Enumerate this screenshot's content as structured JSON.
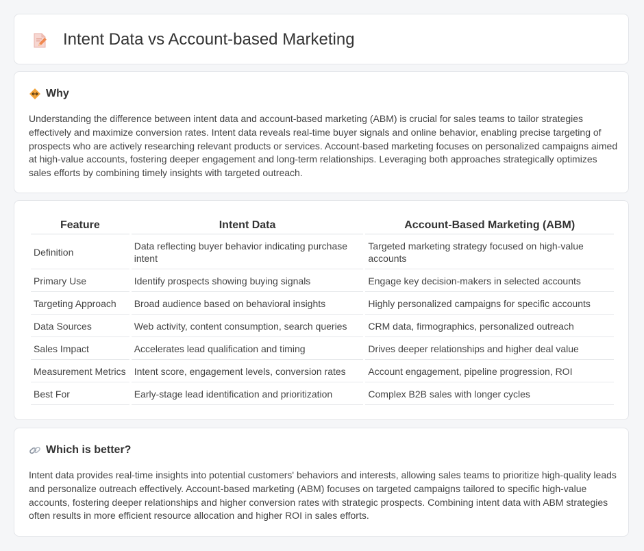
{
  "header": {
    "title": "Intent Data vs Account-based Marketing",
    "icon": "document-pencil-icon"
  },
  "why": {
    "title": "Why",
    "icon": "diamond-arrows-icon",
    "body": "Understanding the difference between intent data and account-based marketing (ABM) is crucial for sales teams to tailor strategies effectively and maximize conversion rates. Intent data reveals real-time buyer signals and online behavior, enabling precise targeting of prospects who are actively researching relevant products or services. Account-based marketing focuses on personalized campaigns aimed at high-value accounts, fostering deeper engagement and long-term relationships. Leveraging both approaches strategically optimizes sales efforts by combining timely insights with targeted outreach."
  },
  "comparison": {
    "headers": [
      "Feature",
      "Intent Data",
      "Account-Based Marketing (ABM)"
    ],
    "rows": [
      [
        "Definition",
        "Data reflecting buyer behavior indicating purchase intent",
        "Targeted marketing strategy focused on high-value accounts"
      ],
      [
        "Primary Use",
        "Identify prospects showing buying signals",
        "Engage key decision-makers in selected accounts"
      ],
      [
        "Targeting Approach",
        "Broad audience based on behavioral insights",
        "Highly personalized campaigns for specific accounts"
      ],
      [
        "Data Sources",
        "Web activity, content consumption, search queries",
        "CRM data, firmographics, personalized outreach"
      ],
      [
        "Sales Impact",
        "Accelerates lead qualification and timing",
        "Drives deeper relationships and higher deal value"
      ],
      [
        "Measurement Metrics",
        "Intent score, engagement levels, conversion rates",
        "Account engagement, pipeline progression, ROI"
      ],
      [
        "Best For",
        "Early-stage lead identification and prioritization",
        "Complex B2B sales with longer cycles"
      ]
    ]
  },
  "better": {
    "title": "Which is better?",
    "icon": "link-icon",
    "body": "Intent data provides real-time insights into potential customers' behaviors and interests, allowing sales teams to prioritize high-quality leads and personalize outreach effectively. Account-based marketing (ABM) focuses on targeted campaigns tailored to specific high-value accounts, fostering deeper relationships and higher conversion rates with strategic prospects. Combining intent data with ABM strategies often results in more efficient resource allocation and higher ROI in sales efforts."
  }
}
